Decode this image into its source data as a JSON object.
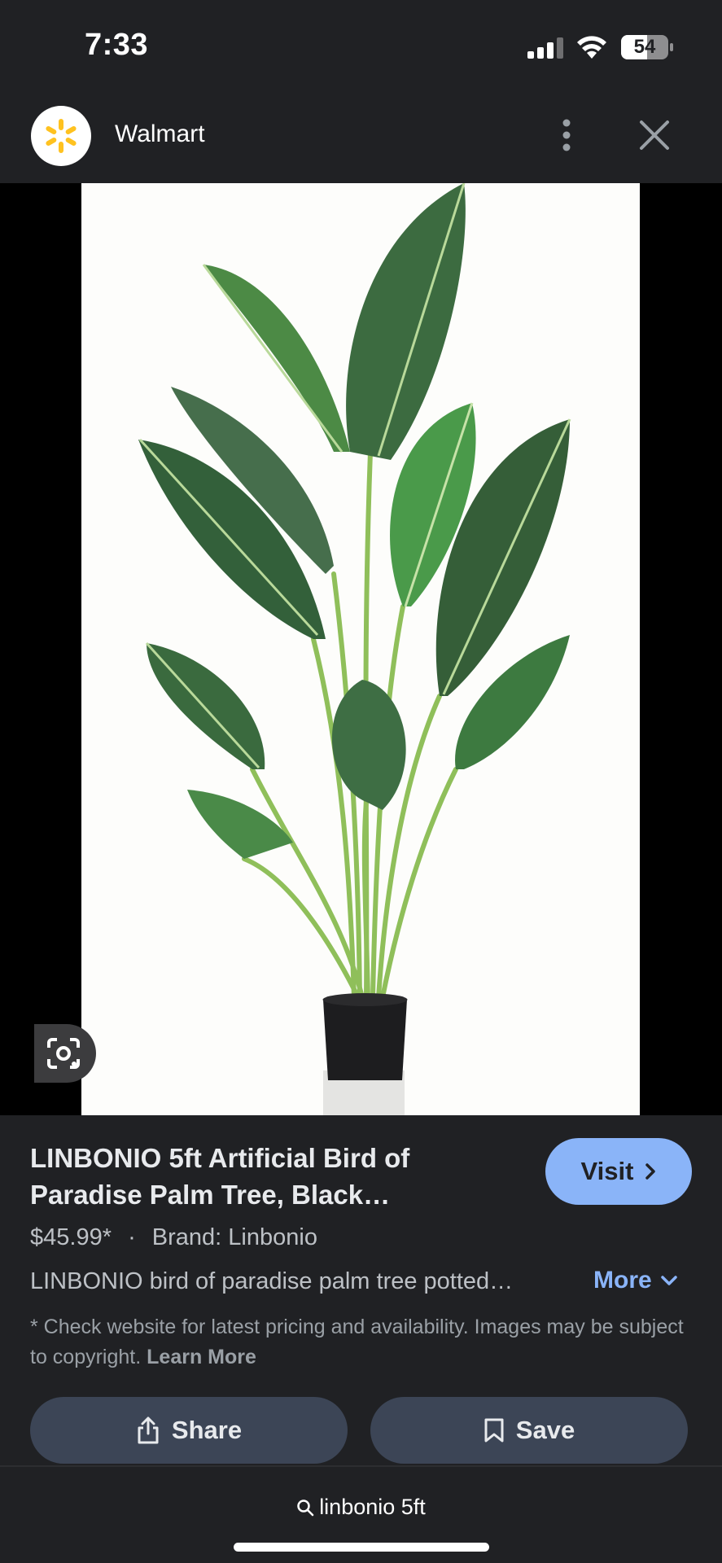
{
  "status_bar": {
    "time": "7:33",
    "battery": "54",
    "icons": [
      "signal-icon",
      "wifi-icon",
      "battery-icon"
    ]
  },
  "header": {
    "site_name": "Walmart",
    "logo_icon": "walmart-spark-logo",
    "menu_icon": "more-vert-icon",
    "close_icon": "close-icon"
  },
  "image": {
    "alt": "artificial bird of paradise palm tree in black pot",
    "lens_icon": "lens-icon"
  },
  "product": {
    "title": "LINBONIO 5ft Artificial Bird of Paradise Palm Tree, Black…",
    "visit_label": "Visit",
    "price": "$45.99*",
    "separator": "·",
    "brand": "Brand: Linbonio",
    "description": "LINBONIO bird of paradise palm tree potted…",
    "more_label": "More",
    "disclaimer": "* Check website for latest pricing and availability. Images may be subject to copyright.",
    "learn_more": "Learn More"
  },
  "actions": {
    "share_label": "Share",
    "save_label": "Save"
  },
  "search": {
    "query": "linbonio 5ft"
  },
  "colors": {
    "background": "#202124",
    "accent": "#8ab4f8",
    "button_bg": "#3c4556",
    "walmart_yellow": "#ffc220"
  }
}
